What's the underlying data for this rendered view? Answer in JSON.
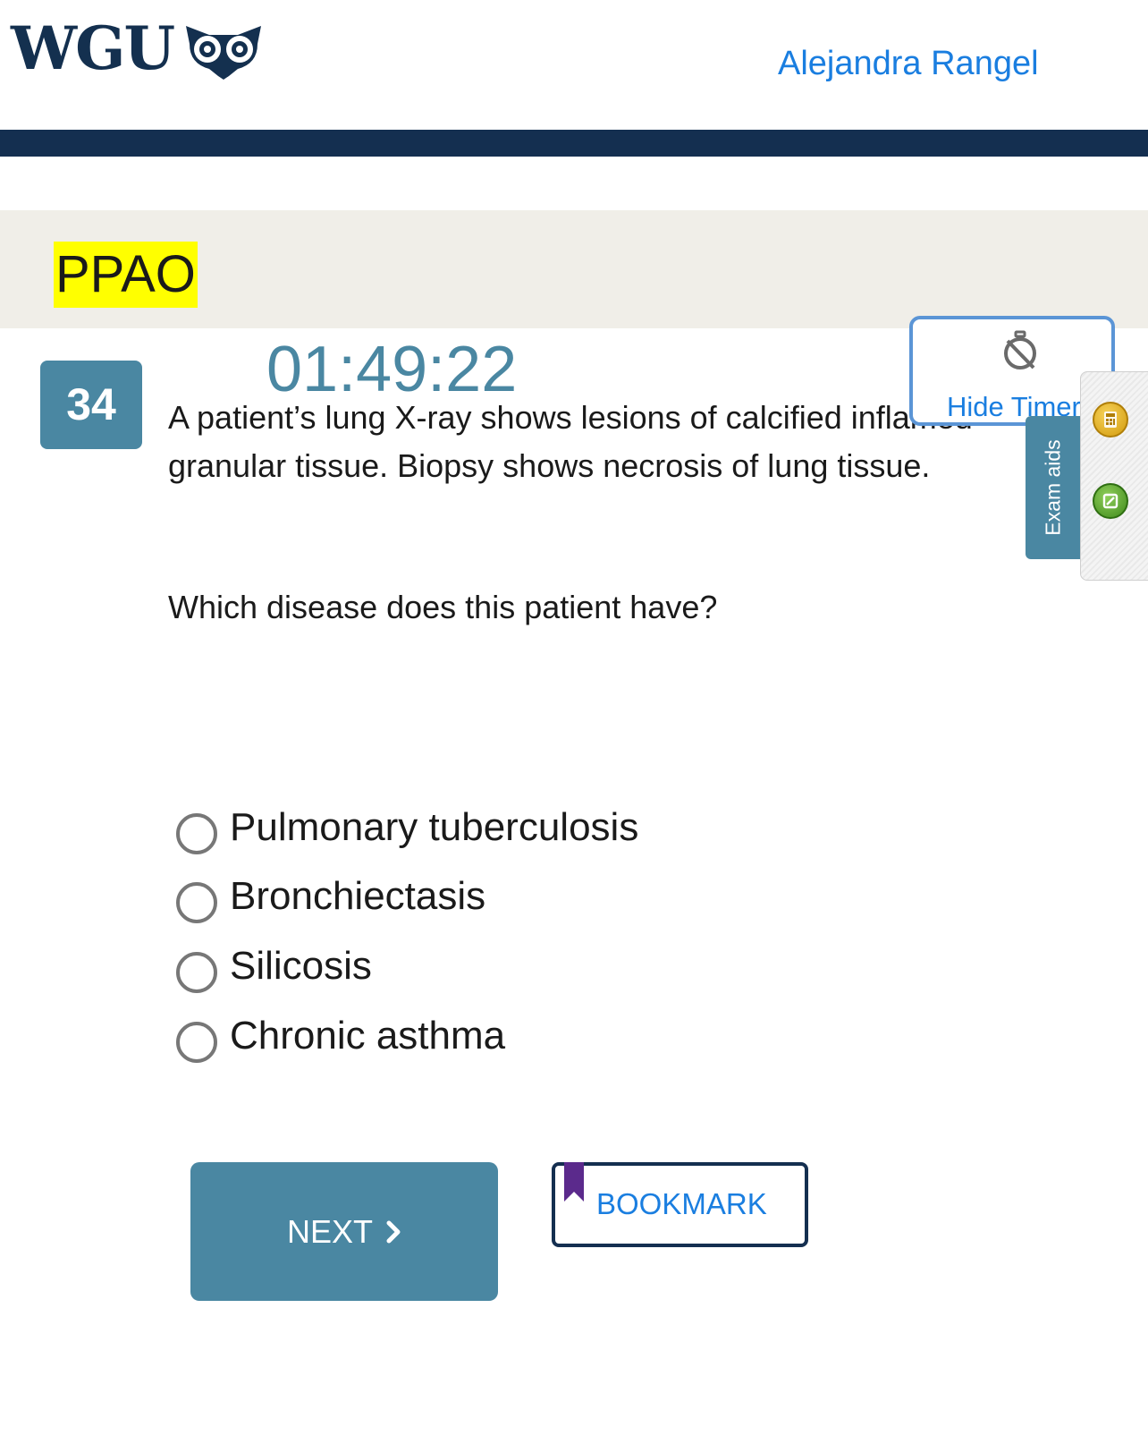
{
  "header": {
    "logo_text": "WGU",
    "logo_icon": "owl-icon",
    "user_name": "Alejandra Rangel"
  },
  "course": {
    "code": "PPAO"
  },
  "question": {
    "number": "34",
    "timer": "01:49:22",
    "stem": "A patient’s lung X-ray shows lesions of calcified inflamed granular tissue. Biopsy shows necrosis of lung tissue.",
    "prompt": "Which disease does this patient have?",
    "options": [
      {
        "label": "Pulmonary tuberculosis",
        "selected": false
      },
      {
        "label": "Bronchiectasis",
        "selected": false
      },
      {
        "label": "Silicosis",
        "selected": false
      },
      {
        "label": "Chronic asthma",
        "selected": false
      }
    ]
  },
  "hide_timer": {
    "label": "Hide Timer",
    "icon": "stopwatch-off-icon"
  },
  "exam_aids": {
    "label": "Exam aids",
    "tools": [
      {
        "icon": "calculator-icon"
      },
      {
        "icon": "notes-icon"
      }
    ]
  },
  "actions": {
    "next_label": "NEXT",
    "bookmark_label": "BOOKMARK"
  },
  "colors": {
    "brand_navy": "#142f50",
    "accent_teal": "#4a87a2",
    "link_blue": "#1a7ee0",
    "highlight_yellow": "#ffff00",
    "bookmark_purple": "#5b2a8c"
  }
}
